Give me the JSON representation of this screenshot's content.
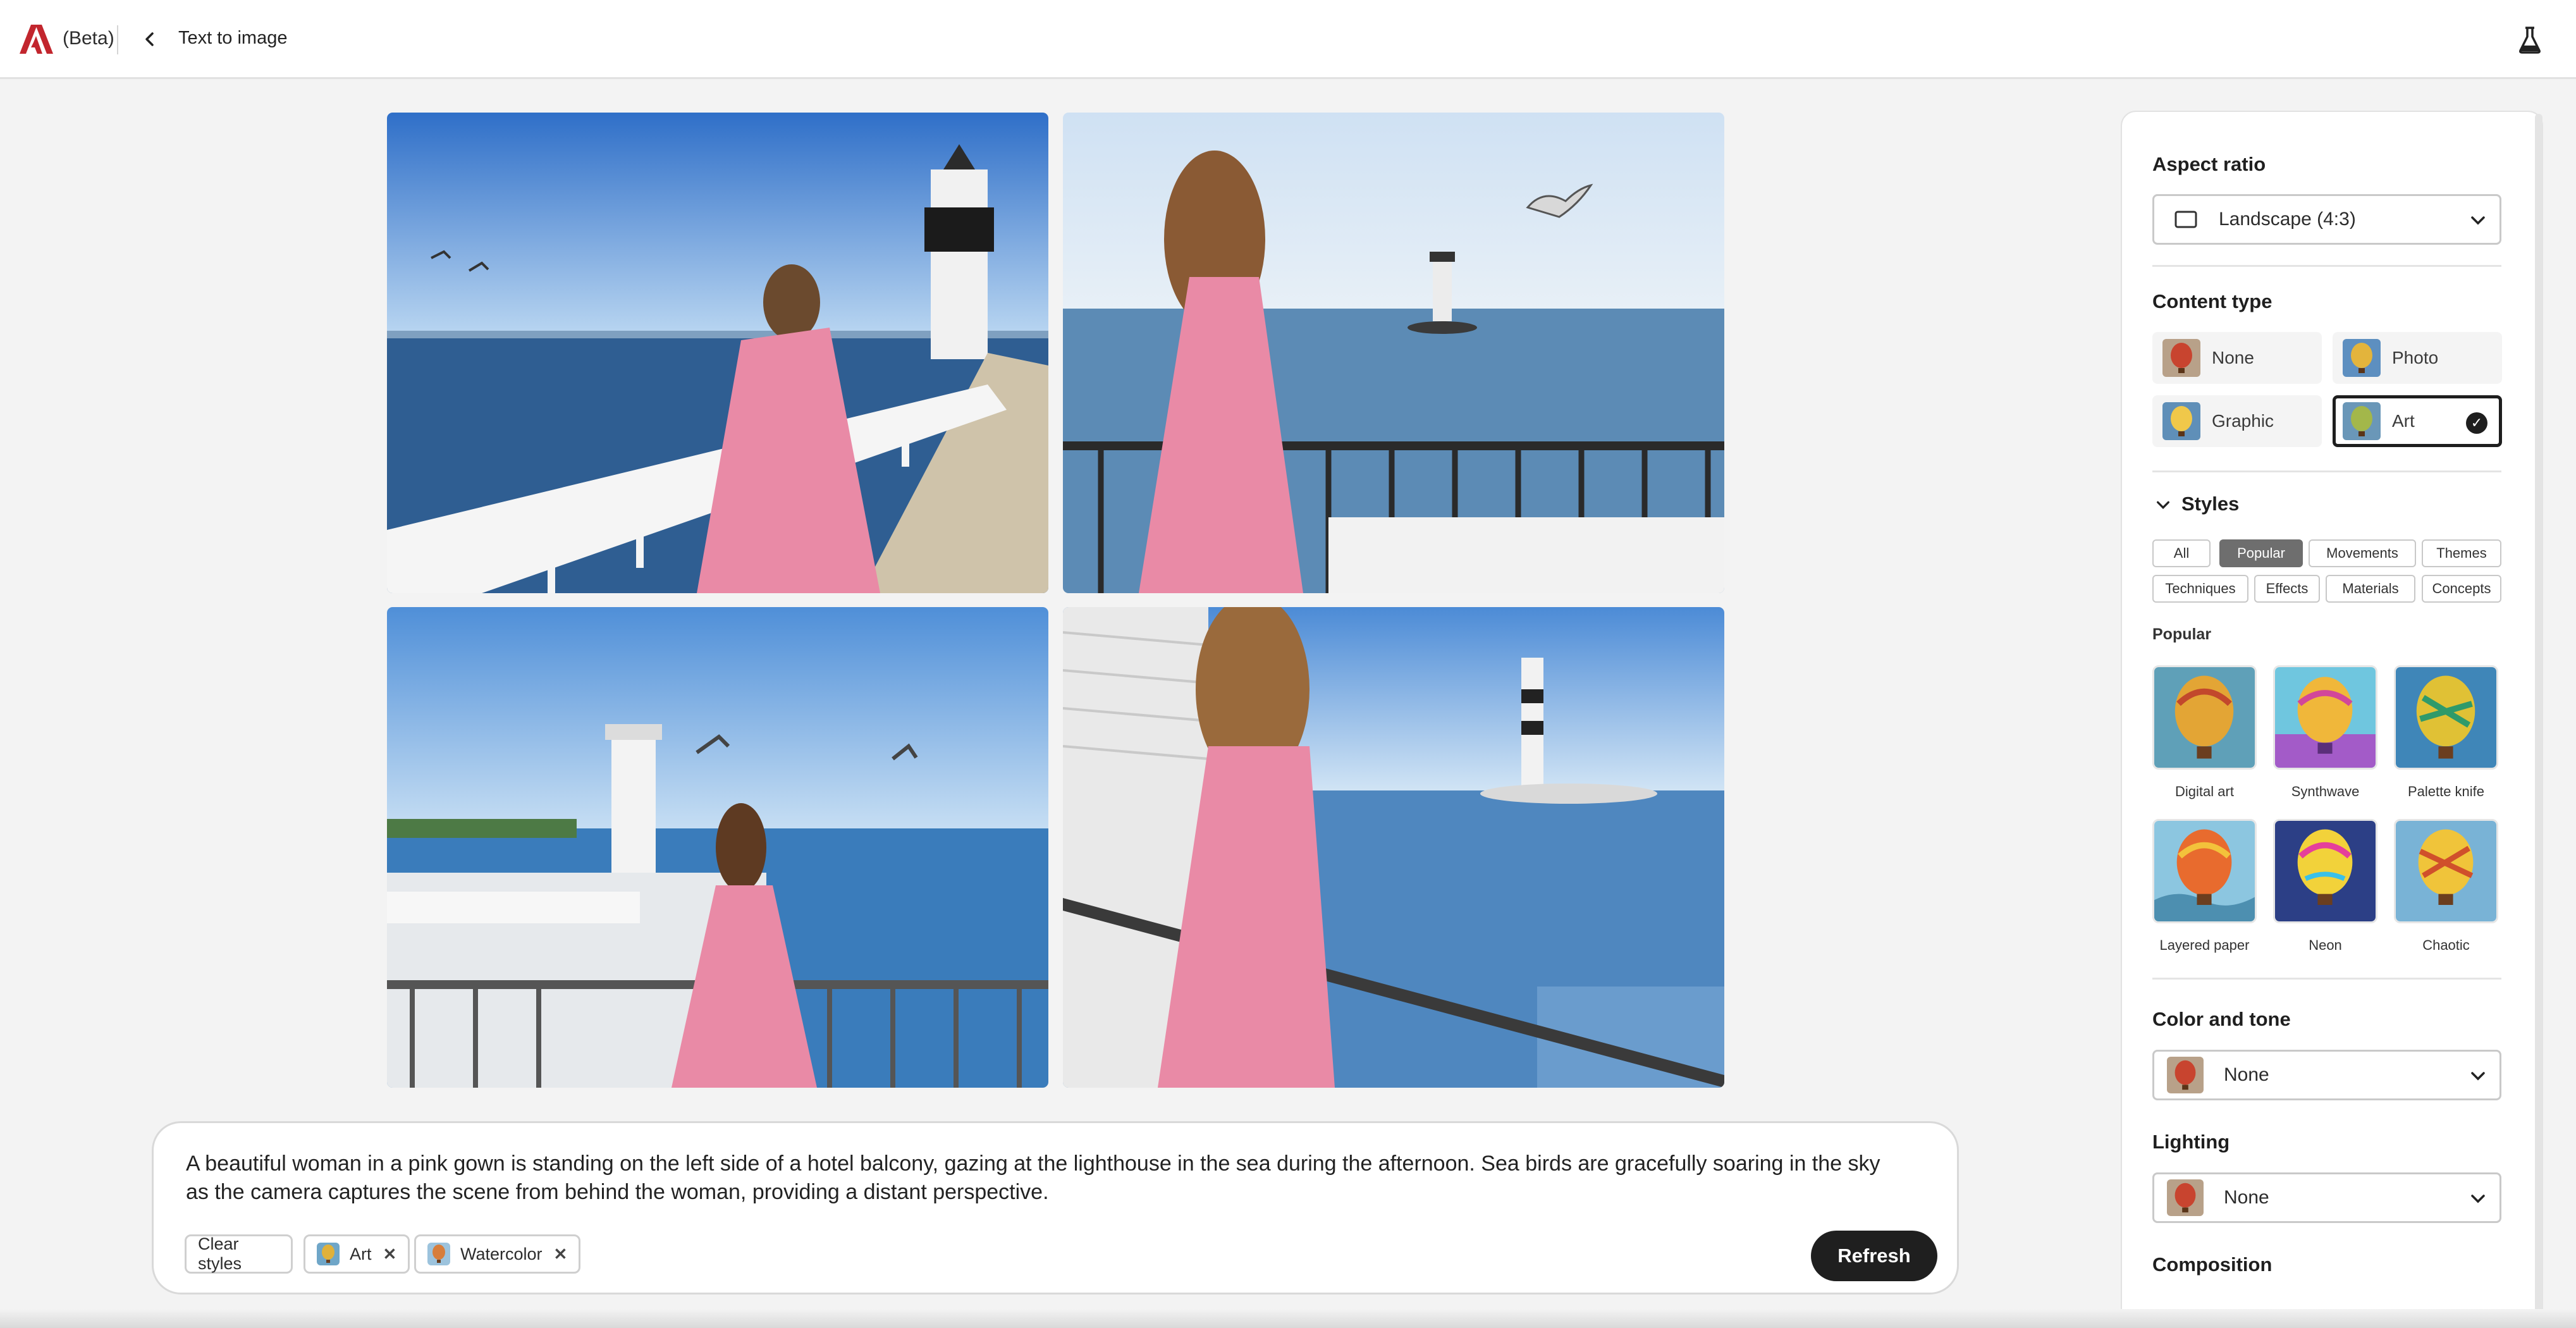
{
  "header": {
    "beta_label": "(Beta)",
    "title": "Text to image",
    "icons": [
      "adobe-logo",
      "chevron-left-icon",
      "beaker-icon"
    ]
  },
  "images": [
    {
      "label": "generated-image-1"
    },
    {
      "label": "generated-image-2"
    },
    {
      "label": "generated-image-3"
    },
    {
      "label": "generated-image-4"
    }
  ],
  "prompt": {
    "text": "A beautiful woman in a pink gown is standing on the left side of a hotel balcony, gazing at the lighthouse in the sea during the afternoon. Sea birds are gracefully soaring in the sky as the camera captures the scene from behind the woman, providing a distant perspective.",
    "clear_label": "Clear styles",
    "chips": [
      "Art",
      "Watercolor"
    ],
    "refresh_label": "Refresh"
  },
  "panel": {
    "aspect_ratio": {
      "title": "Aspect ratio",
      "value": "Landscape (4:3)"
    },
    "content_type": {
      "title": "Content type",
      "options": [
        "None",
        "Photo",
        "Graphic",
        "Art"
      ],
      "selected": "Art"
    },
    "styles": {
      "title": "Styles",
      "tabs": [
        "All",
        "Popular",
        "Movements",
        "Themes",
        "Techniques",
        "Effects",
        "Materials",
        "Concepts"
      ],
      "active_tab": "Popular",
      "section_label": "Popular",
      "items": [
        "Digital art",
        "Synthwave",
        "Palette knife",
        "Layered paper",
        "Neon",
        "Chaotic"
      ]
    },
    "color_tone": {
      "title": "Color and tone",
      "value": "None"
    },
    "lighting": {
      "title": "Lighting",
      "value": "None"
    },
    "composition": {
      "title": "Composition"
    }
  },
  "colors": {
    "accent_dark": "#1f1f1f",
    "adobe_red": "#c2262e",
    "gown_pink": "#e98aa6",
    "sea_blue": "#3f6fa0"
  }
}
